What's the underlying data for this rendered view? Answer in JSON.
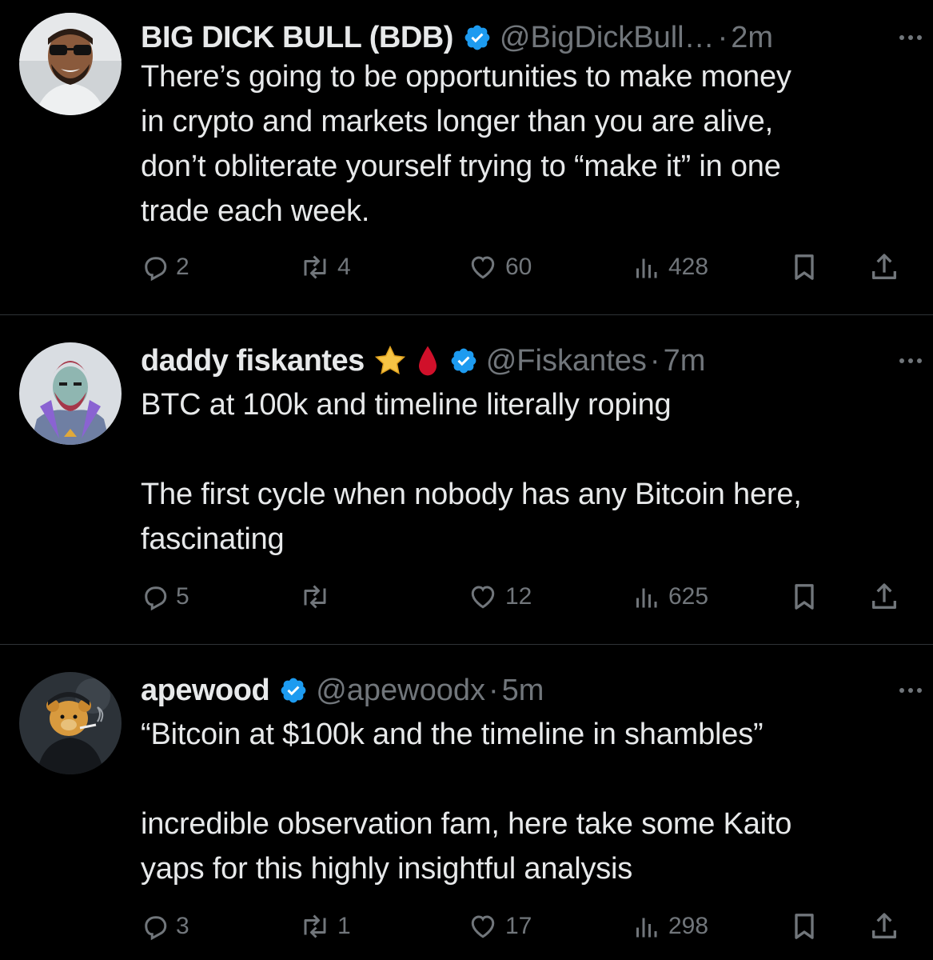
{
  "colors": {
    "background": "#000000",
    "text": "#e7e9ea",
    "muted": "#71767b",
    "verified": "#1d9bf0",
    "divider": "#2f3336"
  },
  "tweets": [
    {
      "name": "BIG DICK BULL (BDB)",
      "verified": true,
      "emojis": [],
      "handle": "@BigDickBull…",
      "separator": "·",
      "time": "2m",
      "more_icon": "more-dots-icon",
      "text_lines": [
        "There’s going to be opportunities to make money",
        "in crypto and markets longer than you are alive,",
        "don’t obliterate yourself trying to “make it” in one",
        "trade each week."
      ],
      "stats": {
        "replies": "2",
        "reposts": "4",
        "likes": "60",
        "views": "428"
      }
    },
    {
      "name": "daddy fiskantes",
      "verified": true,
      "emojis": [
        "star-emoji",
        "blood-drop-emoji"
      ],
      "handle": "@Fiskantes",
      "separator": "·",
      "time": "7m",
      "more_icon": "more-dots-icon",
      "text_lines": [
        "BTC at 100k and timeline literally roping",
        "",
        "The first cycle when nobody has any Bitcoin here,",
        "fascinating"
      ],
      "stats": {
        "replies": "5",
        "reposts": "",
        "likes": "12",
        "views": "625"
      }
    },
    {
      "name": "apewood",
      "verified": true,
      "emojis": [],
      "handle": "@apewoodx",
      "separator": "·",
      "time": "5m",
      "more_icon": "more-dots-icon",
      "text_lines": [
        "“Bitcoin at $100k and the timeline in shambles”",
        "",
        "incredible observation fam, here take some Kaito",
        "yaps for this highly insightful analysis"
      ],
      "stats": {
        "replies": "3",
        "reposts": "1",
        "likes": "17",
        "views": "298"
      }
    }
  ]
}
